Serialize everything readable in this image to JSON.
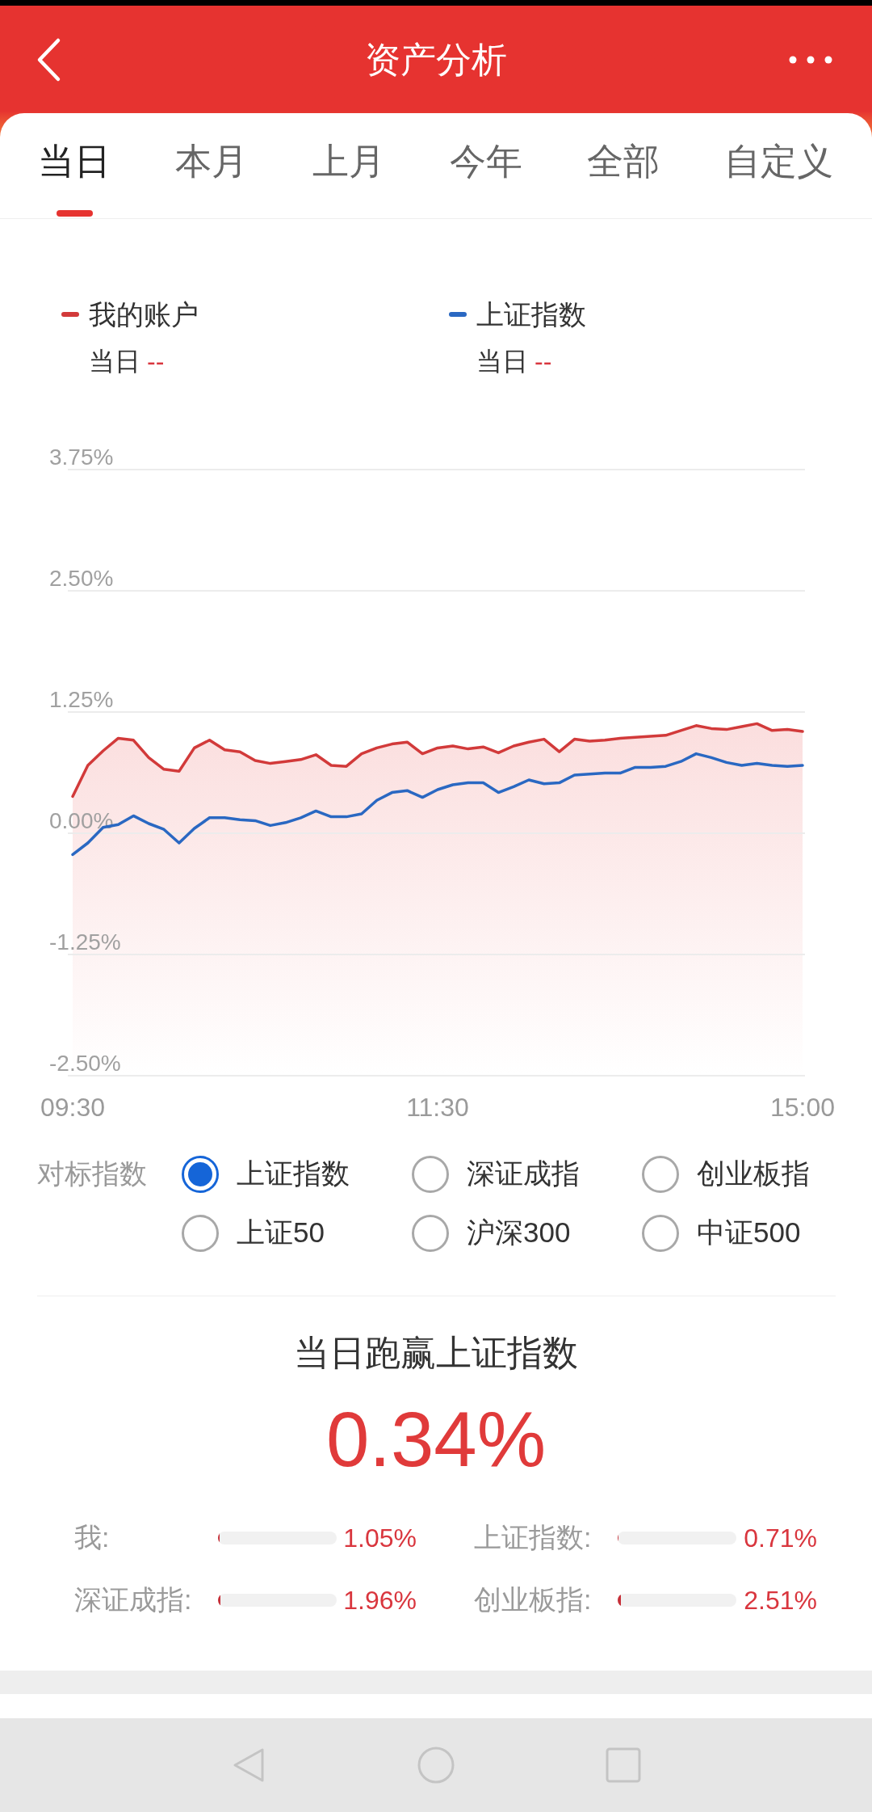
{
  "header": {
    "title": "资产分析"
  },
  "tabs": [
    {
      "label": "当日",
      "selected": true
    },
    {
      "label": "本月",
      "selected": false
    },
    {
      "label": "上月",
      "selected": false
    },
    {
      "label": "今年",
      "selected": false
    },
    {
      "label": "全部",
      "selected": false
    },
    {
      "label": "自定义",
      "selected": false
    }
  ],
  "chart": {
    "legend": [
      {
        "period": "当日",
        "value": "--"
      },
      {
        "period": "当日",
        "value": "--"
      }
    ],
    "chart_data": {
      "type": "line",
      "grid": true,
      "categories": [
        "09:30",
        null,
        null,
        null,
        null,
        null,
        null,
        null,
        null,
        null,
        null,
        null,
        null,
        null,
        null,
        null,
        null,
        null,
        null,
        null,
        null,
        null,
        null,
        null,
        "11:30",
        null,
        null,
        null,
        null,
        null,
        null,
        null,
        null,
        null,
        null,
        null,
        null,
        null,
        null,
        null,
        null,
        null,
        null,
        null,
        null,
        null,
        null,
        null,
        "15:00"
      ],
      "ylim": [
        -2.5,
        3.75
      ],
      "yticks": [
        {
          "value": 3.75,
          "label": "3.75%"
        },
        {
          "value": 2.5,
          "label": "2.50%"
        },
        {
          "value": 1.25,
          "label": "1.25%"
        },
        {
          "value": 0,
          "label": "0.00%"
        },
        {
          "value": -1.25,
          "label": "-1.25%"
        },
        {
          "value": -2.5,
          "label": "-2.50%"
        }
      ],
      "series": [
        {
          "name": "我的账户",
          "color": "#d23a3a",
          "values": [
            0.38,
            0.7,
            0.85,
            0.98,
            0.96,
            0.78,
            0.66,
            0.64,
            0.88,
            0.96,
            0.86,
            0.84,
            0.75,
            0.72,
            0.74,
            0.76,
            0.81,
            0.7,
            0.69,
            0.82,
            0.88,
            0.92,
            0.94,
            0.82,
            0.88,
            0.9,
            0.87,
            0.89,
            0.83,
            0.9,
            0.94,
            0.97,
            0.84,
            0.97,
            0.95,
            0.96,
            0.98,
            0.99,
            1.0,
            1.01,
            1.06,
            1.11,
            1.08,
            1.07,
            1.1,
            1.13,
            1.06,
            1.07,
            1.05
          ]
        },
        {
          "name": "上证指数",
          "color": "#2a68c2",
          "values": [
            -0.22,
            -0.1,
            0.06,
            0.09,
            0.18,
            0.1,
            0.04,
            -0.1,
            0.05,
            0.16,
            0.16,
            0.14,
            0.13,
            0.08,
            0.11,
            0.16,
            0.23,
            0.17,
            0.17,
            0.2,
            0.34,
            0.42,
            0.44,
            0.37,
            0.45,
            0.5,
            0.52,
            0.52,
            0.42,
            0.48,
            0.55,
            0.51,
            0.52,
            0.6,
            0.61,
            0.62,
            0.62,
            0.68,
            0.68,
            0.69,
            0.74,
            0.82,
            0.78,
            0.73,
            0.7,
            0.72,
            0.7,
            0.69,
            0.7
          ]
        }
      ]
    }
  },
  "benchmark": {
    "label": "对标指数",
    "options": [
      {
        "label": "上证指数",
        "selected": true
      },
      {
        "label": "深证成指",
        "selected": false
      },
      {
        "label": "创业板指",
        "selected": false
      },
      {
        "label": "上证50",
        "selected": false
      },
      {
        "label": "沪深300",
        "selected": false
      },
      {
        "label": "中证500",
        "selected": false
      }
    ]
  },
  "summary": {
    "title": "当日跑赢上证指数",
    "value": "0.34%",
    "comparisons": [
      {
        "label": "我:",
        "level": 0.0105,
        "reading": "1.05%"
      },
      {
        "label": "上证指数:",
        "level": 0.0071,
        "reading": "0.71%"
      },
      {
        "label": "深证成指:",
        "level": 0.0196,
        "reading": "1.96%"
      },
      {
        "label": "创业板指:",
        "level": 0.0251,
        "reading": "2.51%"
      }
    ]
  }
}
